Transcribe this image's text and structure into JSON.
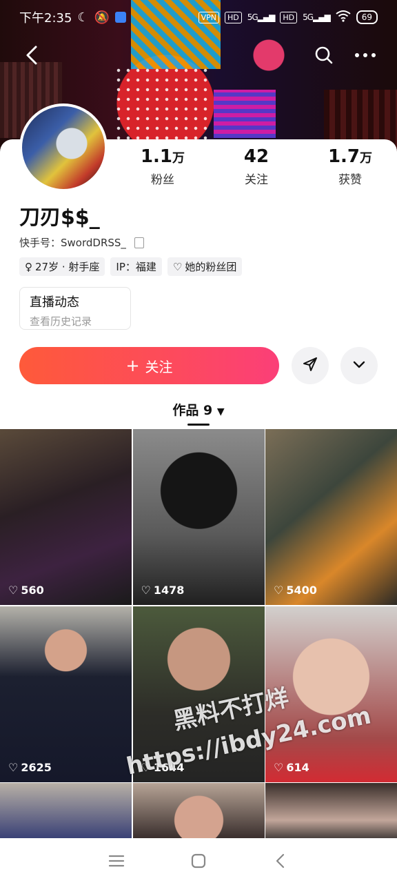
{
  "status_bar": {
    "time": "下午2:35",
    "vpn": "VPN",
    "hd1": "HD",
    "net1": "5G",
    "hd2": "HD",
    "net2": "5G",
    "battery": "69"
  },
  "profile": {
    "name": "刀刃$$_",
    "kuaishou_id": "快手号：SwordDRSS_",
    "chips": [
      "27岁 · 射手座",
      "IP：福建",
      "她的粉丝团"
    ],
    "stats": [
      {
        "value": "1.1",
        "unit": "万",
        "label": "粉丝"
      },
      {
        "value": "42",
        "unit": "",
        "label": "关注"
      },
      {
        "value": "1.7",
        "unit": "万",
        "label": "获赞"
      }
    ],
    "live": {
      "title": "直播动态",
      "subtitle": "查看历史记录"
    },
    "follow_label": "关注"
  },
  "tab": {
    "label": "作品 9"
  },
  "works": [
    {
      "likes": "560"
    },
    {
      "likes": "1478"
    },
    {
      "likes": "5400"
    },
    {
      "likes": "2625"
    },
    {
      "likes": "1644"
    },
    {
      "likes": "614"
    },
    {
      "likes": ""
    },
    {
      "likes": ""
    },
    {
      "likes": ""
    }
  ],
  "watermark": {
    "line1": "黑料不打烊",
    "line2": "https://ibdy24.com"
  },
  "icons": {
    "back": "chevron-left-icon",
    "search": "search-icon",
    "more": "more-dots-icon",
    "share": "send-icon",
    "expand": "chevron-down-icon",
    "heart": "heart-icon",
    "menu": "menu-icon",
    "home": "home-square-icon",
    "back_nav": "back-triangle-icon"
  },
  "colors": {
    "accent": "#fd4a5d",
    "follow_start": "#fe5a3a",
    "follow_end": "#fb3f78"
  }
}
